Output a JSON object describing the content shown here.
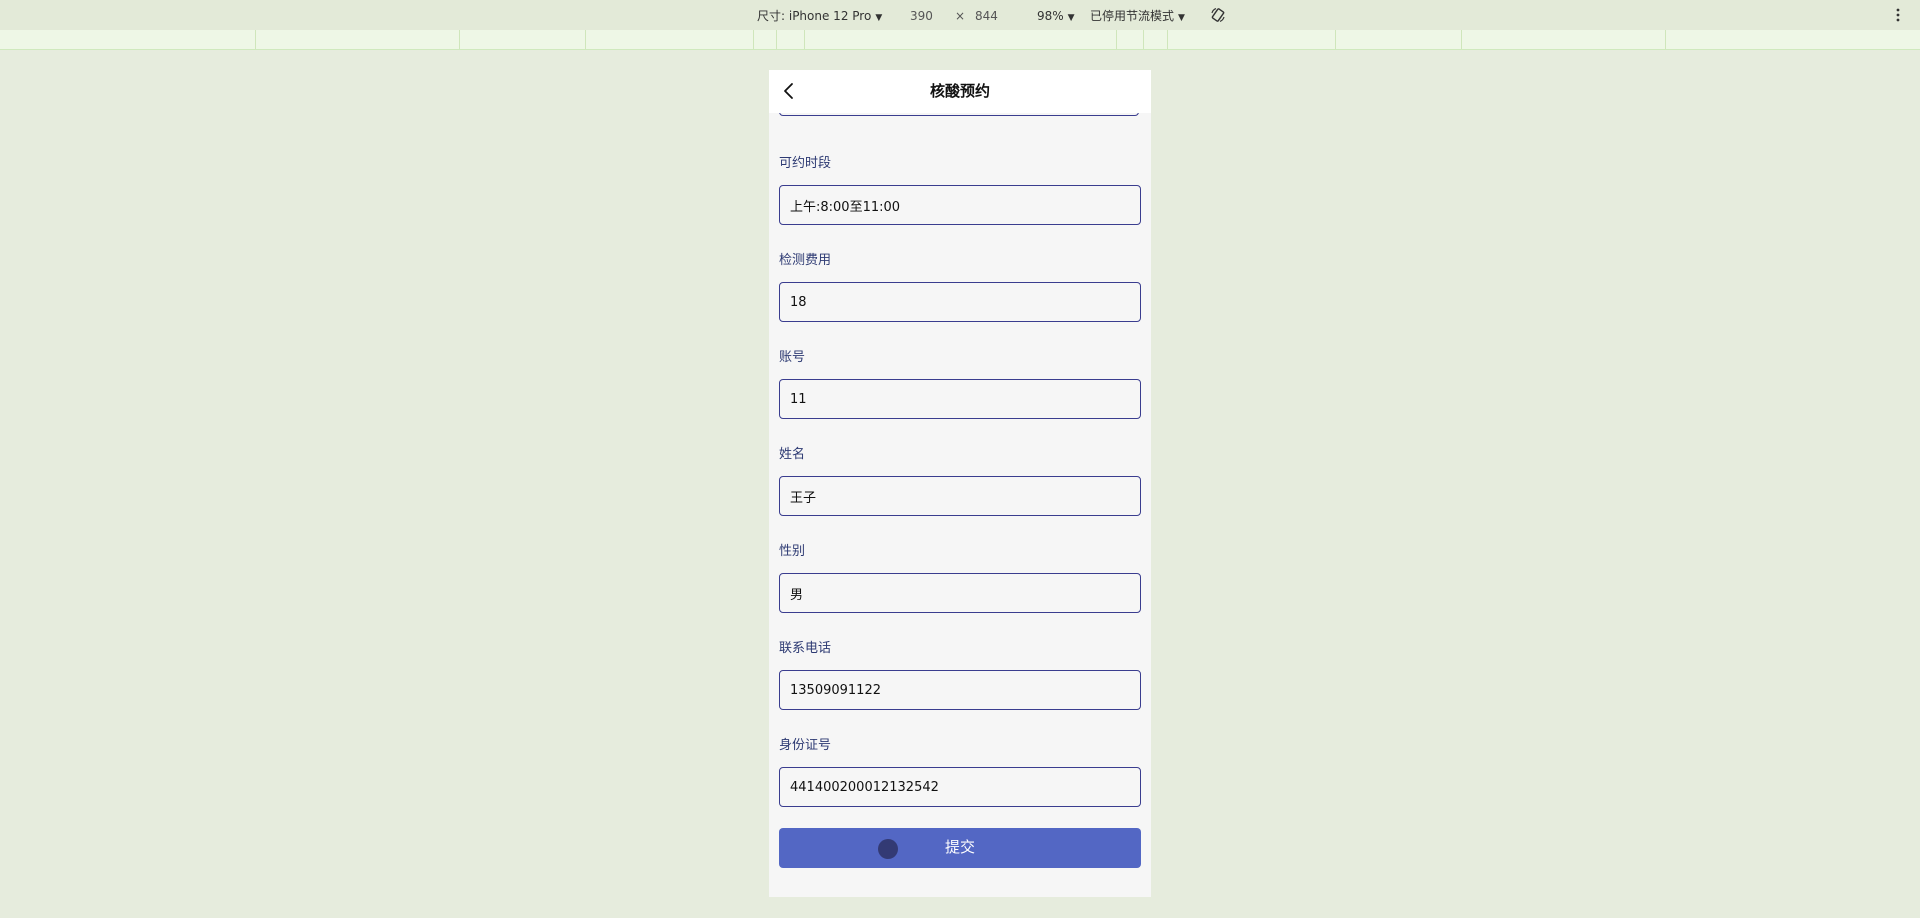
{
  "devtools": {
    "dimensions_label": "尺寸: iPhone 12 Pro",
    "width": "390",
    "times": "×",
    "height": "844",
    "zoom": "98%",
    "throttle": "已停用节流模式"
  },
  "page": {
    "title": "核酸预约"
  },
  "fields": [
    {
      "label": "可约时段",
      "value": "上午:8:00至11:00"
    },
    {
      "label": "检测费用",
      "value": "18"
    },
    {
      "label": "账号",
      "value": "11"
    },
    {
      "label": "姓名",
      "value": "王子"
    },
    {
      "label": "性别",
      "value": "男"
    },
    {
      "label": "联系电话",
      "value": "13509091122"
    },
    {
      "label": "身份证号",
      "value": "441400200012132542"
    }
  ],
  "submit_label": "提交",
  "colors": {
    "accent": "#5367c4",
    "input_border": "#3a3d8f",
    "label": "#2d3a73",
    "background": "#e6ecdd"
  }
}
